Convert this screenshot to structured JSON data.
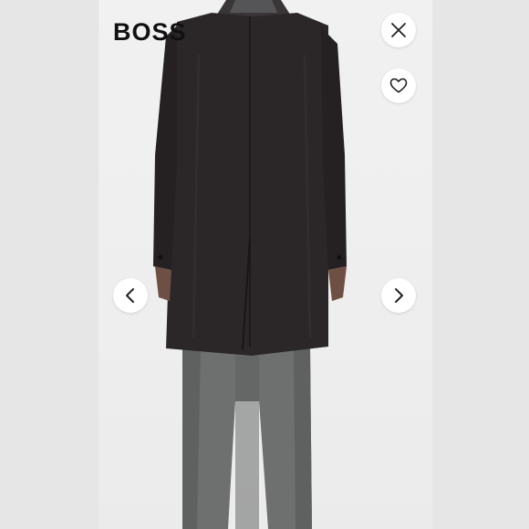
{
  "brand": {
    "logo_text": "BOSS"
  },
  "controls": {
    "close_icon": "close-icon",
    "favorite_icon": "heart-icon",
    "prev_icon": "chevron-left-icon",
    "next_icon": "chevron-right-icon"
  },
  "colors": {
    "background": "#e8e8e8",
    "photo_background": "#f0f0f0",
    "button_background": "#ffffff",
    "icon_color": "#222222",
    "coat": "#2a2628",
    "trousers": "#6c6f6e"
  }
}
